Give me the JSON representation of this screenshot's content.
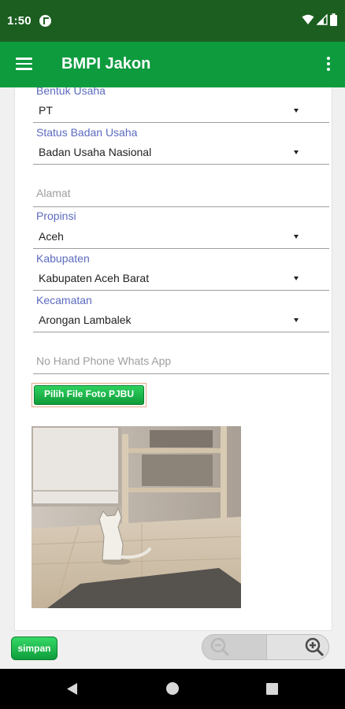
{
  "status_bar": {
    "time": "1:50"
  },
  "app_bar": {
    "title": "BMPI Jakon"
  },
  "form": {
    "bentuk_usaha": {
      "label": "Bentuk Usaha",
      "value": "PT"
    },
    "status_badan_usaha": {
      "label": "Status Badan Usaha",
      "value": "Badan Usaha Nasional"
    },
    "alamat": {
      "placeholder": "Alamat"
    },
    "propinsi": {
      "label": "Propinsi",
      "value": "Aceh"
    },
    "kabupaten": {
      "label": "Kabupaten",
      "value": "Kabupaten Aceh Barat"
    },
    "kecamatan": {
      "label": "Kecamatan",
      "value": "Arongan Lambalek"
    },
    "no_hp": {
      "placeholder": "No Hand Phone Whats App"
    },
    "file_button_label": "Pilih File Foto PJBU"
  },
  "bottom": {
    "save_label": "simpan"
  },
  "colors": {
    "status_bar": "#1b5e20",
    "app_bar": "#0d9b3e",
    "label": "#3f51b5",
    "button_green": "#13a442"
  },
  "icons": [
    "menu-icon",
    "overflow-icon",
    "wifi-icon",
    "signal-icon",
    "battery-icon",
    "zoom-out-icon",
    "zoom-in-icon",
    "back-icon",
    "home-icon",
    "recents-icon"
  ]
}
